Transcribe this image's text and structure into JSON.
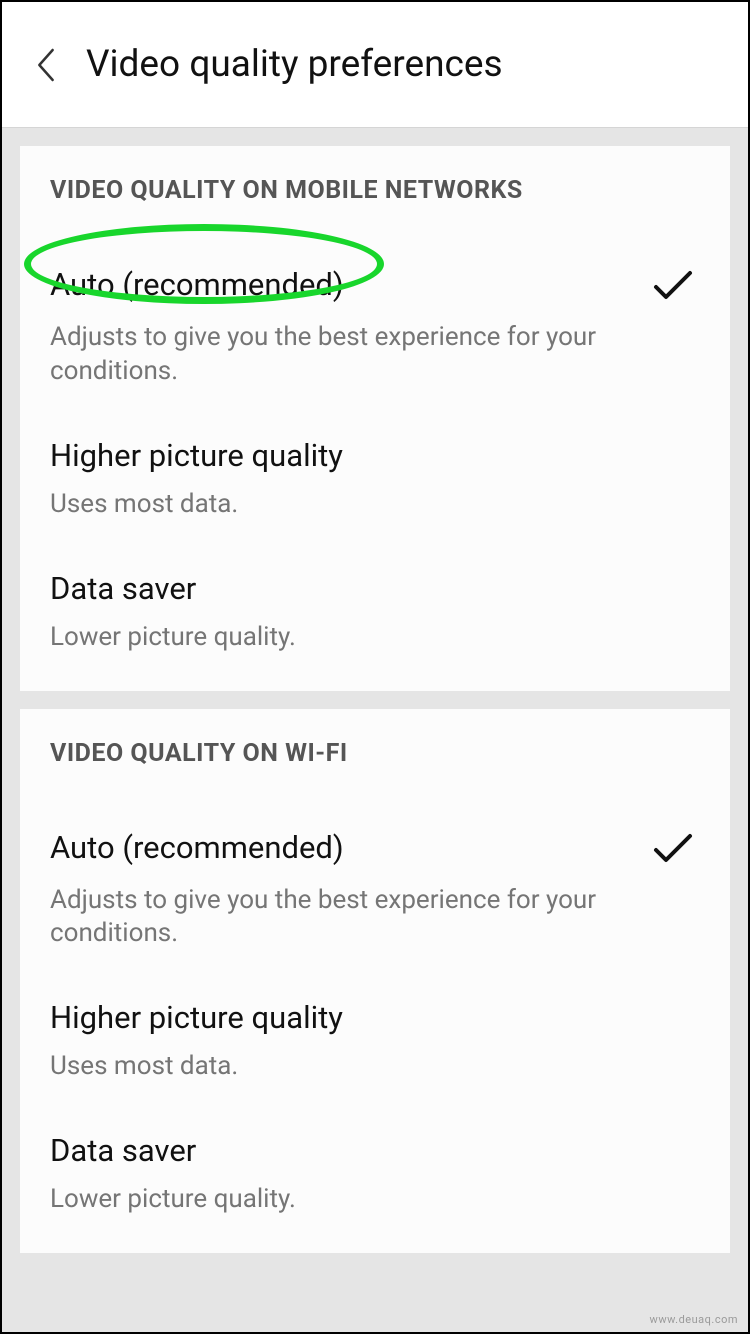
{
  "header": {
    "title": "Video quality preferences"
  },
  "sections": [
    {
      "header": "VIDEO QUALITY ON MOBILE NETWORKS",
      "options": [
        {
          "title": "Auto (recommended)",
          "desc": "Adjusts to give you the best experience for your conditions.",
          "selected": true
        },
        {
          "title": "Higher picture quality",
          "desc": "Uses most data.",
          "selected": false
        },
        {
          "title": "Data saver",
          "desc": "Lower picture quality.",
          "selected": false
        }
      ]
    },
    {
      "header": "VIDEO QUALITY ON WI-FI",
      "options": [
        {
          "title": "Auto (recommended)",
          "desc": "Adjusts to give you the best experience for your conditions.",
          "selected": true
        },
        {
          "title": "Higher picture quality",
          "desc": "Uses most data.",
          "selected": false
        },
        {
          "title": "Data saver",
          "desc": "Lower picture quality.",
          "selected": false
        }
      ]
    }
  ],
  "watermark": "www.deuaq.com"
}
